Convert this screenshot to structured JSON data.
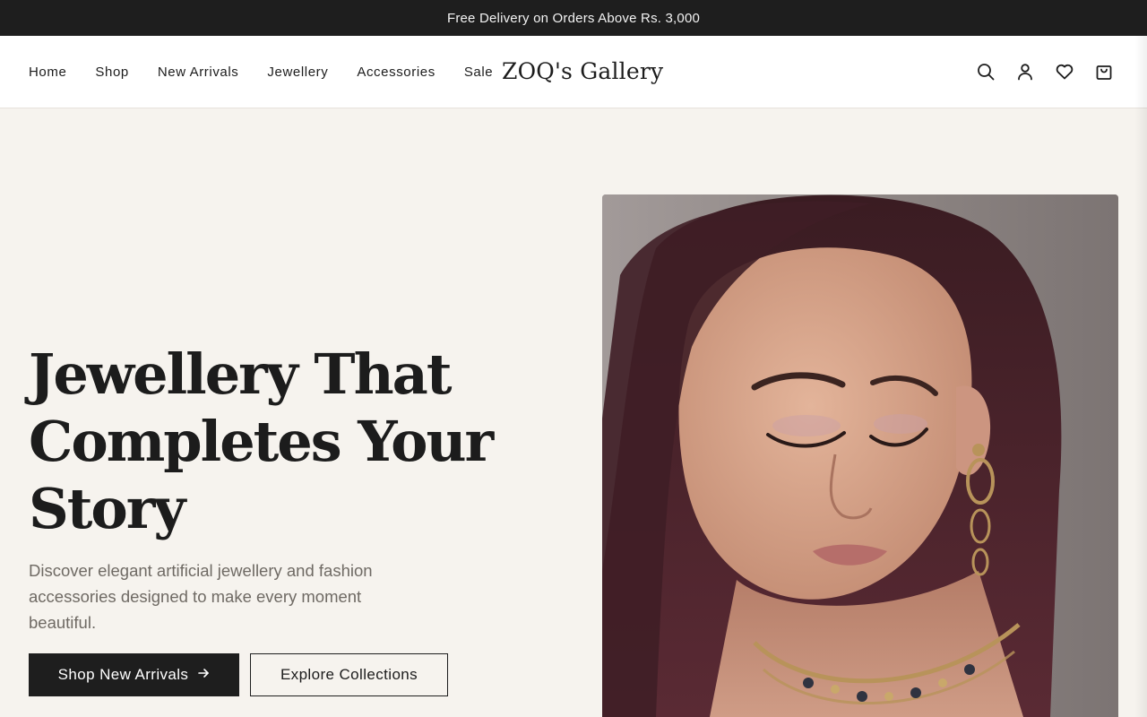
{
  "announcement": "Free Delivery on Orders Above Rs. 3,000",
  "nav": {
    "items": [
      "Home",
      "Shop",
      "New Arrivals",
      "Jewellery",
      "Accessories",
      "Sale"
    ]
  },
  "brand": "ZOQ's Gallery",
  "header_icons": [
    "search-icon",
    "user-icon",
    "heart-icon",
    "shopping-bag-icon"
  ],
  "hero": {
    "title_line1": "Jewellery That",
    "title_line2": "Completes Your",
    "title_line3": "Story",
    "subtitle": "Discover elegant artificial jewellery and fashion accessories designed to make every moment beautiful.",
    "primary_cta": "Shop New Arrivals",
    "secondary_cta": "Explore Collections"
  },
  "colors": {
    "background": "#f6f3ee",
    "dark": "#1e1e1e",
    "muted_text": "#6f6a64"
  }
}
